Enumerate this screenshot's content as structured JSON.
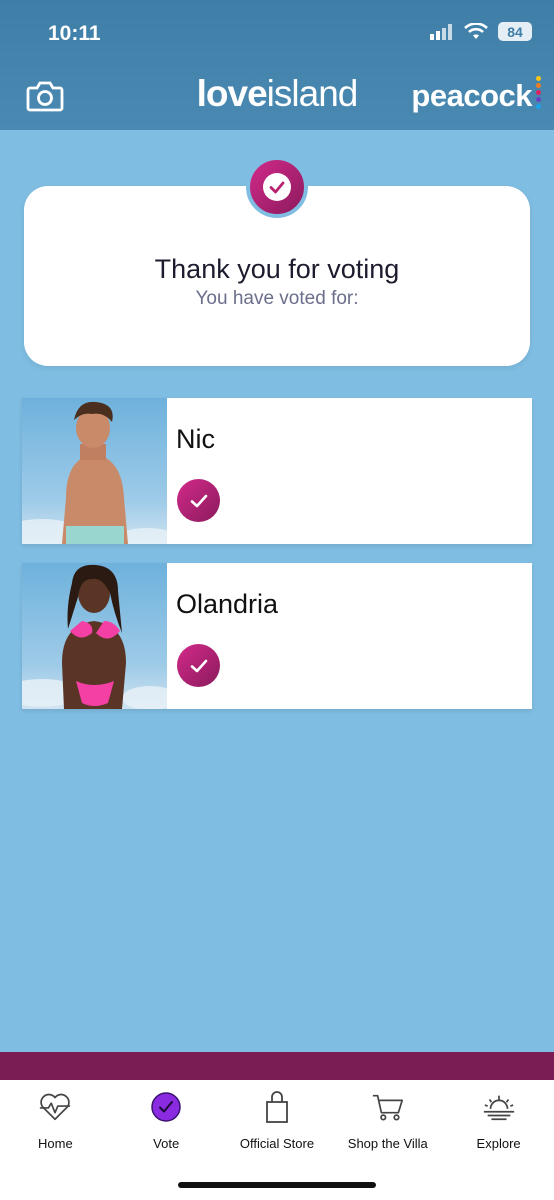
{
  "status_bar": {
    "time": "10:11",
    "battery": "84"
  },
  "header": {
    "logo_love": "love",
    "logo_island": "island",
    "brand": "peacock"
  },
  "main": {
    "title": "Thank you for voting",
    "subtitle": "You have voted for:"
  },
  "contestants": [
    {
      "name": "Nic"
    },
    {
      "name": "Olandria"
    }
  ],
  "tabs": [
    {
      "label": "Home",
      "icon": "heart-pulse-icon"
    },
    {
      "label": "Vote",
      "icon": "vote-check-icon"
    },
    {
      "label": "Official Store",
      "icon": "shopping-bag-icon"
    },
    {
      "label": "Shop the Villa",
      "icon": "shopping-cart-icon"
    },
    {
      "label": "Explore",
      "icon": "sunset-icon"
    }
  ],
  "colors": {
    "background": "#7fbde2",
    "header": "#4a89b2",
    "accent": "#c2237e",
    "bottom_bar": "#7a1d55",
    "vote_tab": "#8a2be2"
  }
}
